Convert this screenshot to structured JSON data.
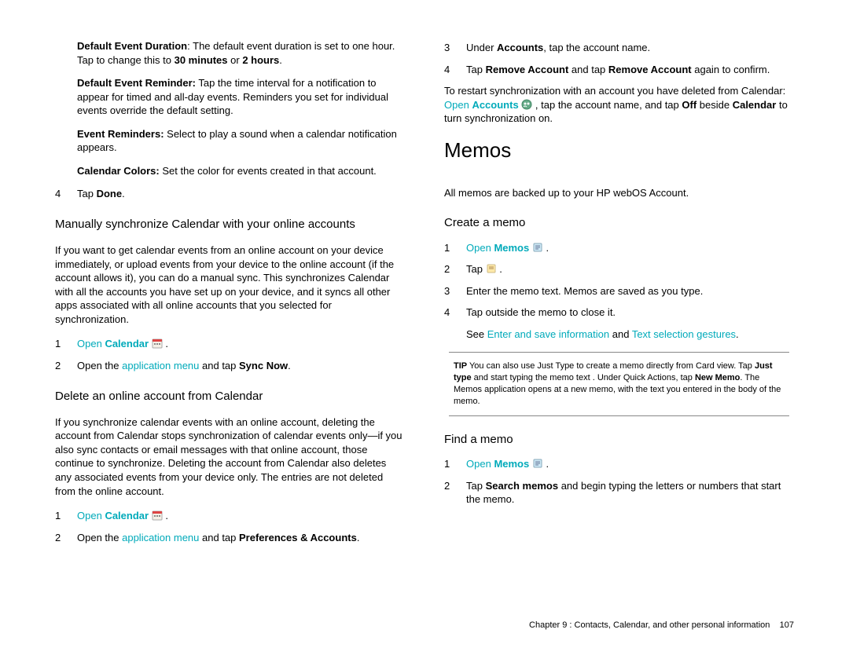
{
  "left": {
    "defs": [
      {
        "label": "Default Event Duration",
        "sep": ":",
        "text": " The default event duration is set to one hour. Tap to change this to ",
        "b1": "30 minutes",
        "mid": " or ",
        "b2": "2 hours",
        "end": "."
      },
      {
        "label": "Default Event Reminder:",
        "sep": "",
        "text": " Tap the time interval for a notification to appear for timed and all-day events. Reminders you set for individual events override the default setting."
      },
      {
        "label": "Event Reminders:",
        "sep": "",
        "text": " Select to play a sound when a calendar notification appears."
      },
      {
        "label": "Calendar Colors:",
        "sep": "",
        "text": " Set the color for events created in that account."
      }
    ],
    "step4": {
      "n": "4",
      "pre": "Tap ",
      "b": "Done",
      "post": "."
    },
    "sec1_title": "Manually synchronize Calendar with your online accounts",
    "sec1_body": "If you want to get calendar events from an online account on your device immediately, or upload events from your device to the online account (if the account allows it), you can do a manual sync. This synchronizes Calendar with all the accounts you have set up on your device, and it syncs all other apps associated with all online accounts that you selected for synchronization.",
    "sec1_step1": {
      "n": "1",
      "link_text": "Open",
      "b": "Calendar",
      "post": " ."
    },
    "sec1_step2": {
      "n": "2",
      "pre": "Open the ",
      "link": "application menu",
      "mid": " and tap ",
      "b": "Sync Now",
      "post": "."
    },
    "sec2_title": "Delete an online account from Calendar",
    "sec2_body": "If you synchronize calendar events with an online account, deleting the account from Calendar stops synchronization of calendar events only—if you also sync contacts or email messages with that online account, those continue to synchronize. Deleting the account from Calendar also deletes any associated events from your device only. The entries are not deleted from the online account.",
    "sec2_step1": {
      "n": "1",
      "link_text": "Open",
      "b": "Calendar",
      "post": " ."
    },
    "sec2_step2": {
      "n": "2",
      "pre": "Open the ",
      "link": "application menu",
      "mid": " and tap ",
      "b": "Preferences & Accounts",
      "post": "."
    }
  },
  "right": {
    "step3": {
      "n": "3",
      "pre": "Under ",
      "b": "Accounts",
      "post": ", tap the account name."
    },
    "step4": {
      "n": "4",
      "pre": "Tap ",
      "b1": "Remove Account",
      "mid": " and tap ",
      "b2": "Remove Account",
      "post": " again to confirm."
    },
    "restart": {
      "pre": "To restart synchronization with an account you have deleted from Calendar: ",
      "link_open": "Open",
      "b1": "Accounts",
      "mid": " , tap the account name, and tap ",
      "b2": "Off",
      "post2": " beside ",
      "b3": "Calendar",
      "end": " to turn synchronization on."
    },
    "memos_title": "Memos",
    "memos_intro": "All memos are backed up to your HP webOS Account.",
    "create_title": "Create a memo",
    "create_step1": {
      "n": "1",
      "link_text": "Open",
      "b": "Memos",
      "post": " ."
    },
    "create_step2": {
      "n": "2",
      "pre": "Tap ",
      "post": " ."
    },
    "create_step3": {
      "n": "3",
      "text": "Enter the memo text. Memos are saved as you type."
    },
    "create_step4": {
      "n": "4",
      "text": "Tap outside the memo to close it."
    },
    "create_see": {
      "pre": "See ",
      "link1": "Enter and save information",
      "mid": " and ",
      "link2": "Text selection gestures",
      "post": "."
    },
    "tip": {
      "label": "TIP",
      "t1": "  You can also use Just Type to create a memo directly from Card view. Tap ",
      "b1": "Just type",
      "t2": " and start typing the memo text . Under Quick Actions, tap ",
      "b2": "New Memo",
      "t3": ". The Memos application opens at a new memo, with the text you entered in the body of the memo."
    },
    "find_title": "Find a memo",
    "find_step1": {
      "n": "1",
      "link_text": "Open",
      "b": "Memos",
      "post": " ."
    },
    "find_step2": {
      "n": "2",
      "pre": "Tap ",
      "b": "Search memos",
      "post": " and begin typing the letters or numbers that start the memo."
    }
  },
  "footer": {
    "chapter": "Chapter 9 :  Contacts, Calendar, and other personal information",
    "page": "107"
  }
}
